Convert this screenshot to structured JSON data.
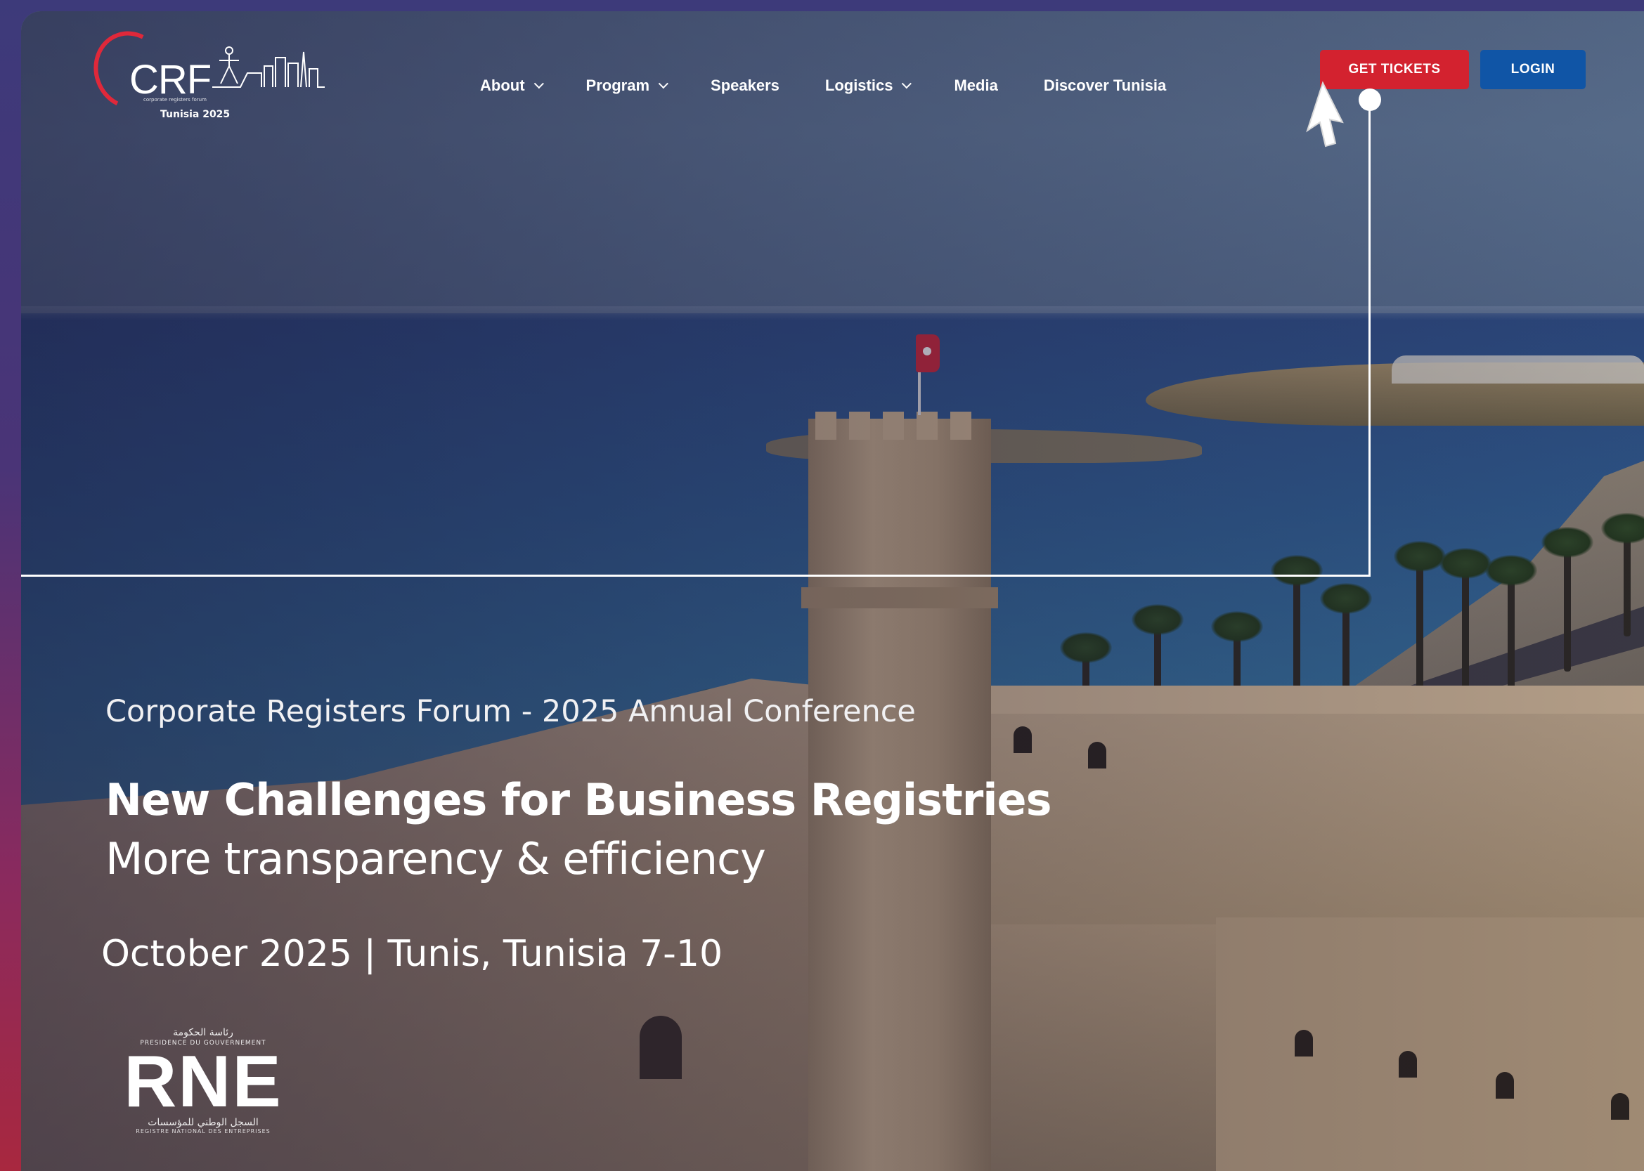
{
  "brand": {
    "logo_text": "CRF",
    "logo_subtitle": "corporate registers forum",
    "logo_year": "Tunisia 2025"
  },
  "nav": {
    "items": [
      {
        "label": "About",
        "has_dropdown": true
      },
      {
        "label": "Program",
        "has_dropdown": true
      },
      {
        "label": "Speakers",
        "has_dropdown": false
      },
      {
        "label": "Logistics",
        "has_dropdown": true
      },
      {
        "label": "Media",
        "has_dropdown": false
      },
      {
        "label": "Discover Tunisia",
        "has_dropdown": false
      }
    ]
  },
  "actions": {
    "tickets_label": "GET TICKETS",
    "login_label": "LOGIN",
    "tickets_color": "#d3222f",
    "login_color": "#1055a6"
  },
  "hero": {
    "kicker": "Corporate Registers Forum - 2025 Annual Conference",
    "title": "New Challenges for Business Registries",
    "subtitle": "More transparency & efficiency",
    "date_location": "October 2025 | Tunis, Tunisia 7-10"
  },
  "partner": {
    "arabic_top": "رئاسة الحكومة",
    "french_top": "PRESIDENCE DU GOUVERNEMENT",
    "mark": "RNE",
    "arabic_bottom": "السجل الوطني للمؤسسات",
    "french_bottom": "REGISTRE NATIONAL DES ENTREPRISES"
  },
  "icons": {
    "dropdown": "chevron-down-icon",
    "cursor": "mouse-pointer-icon",
    "flag": "tunisia-flag-icon"
  }
}
